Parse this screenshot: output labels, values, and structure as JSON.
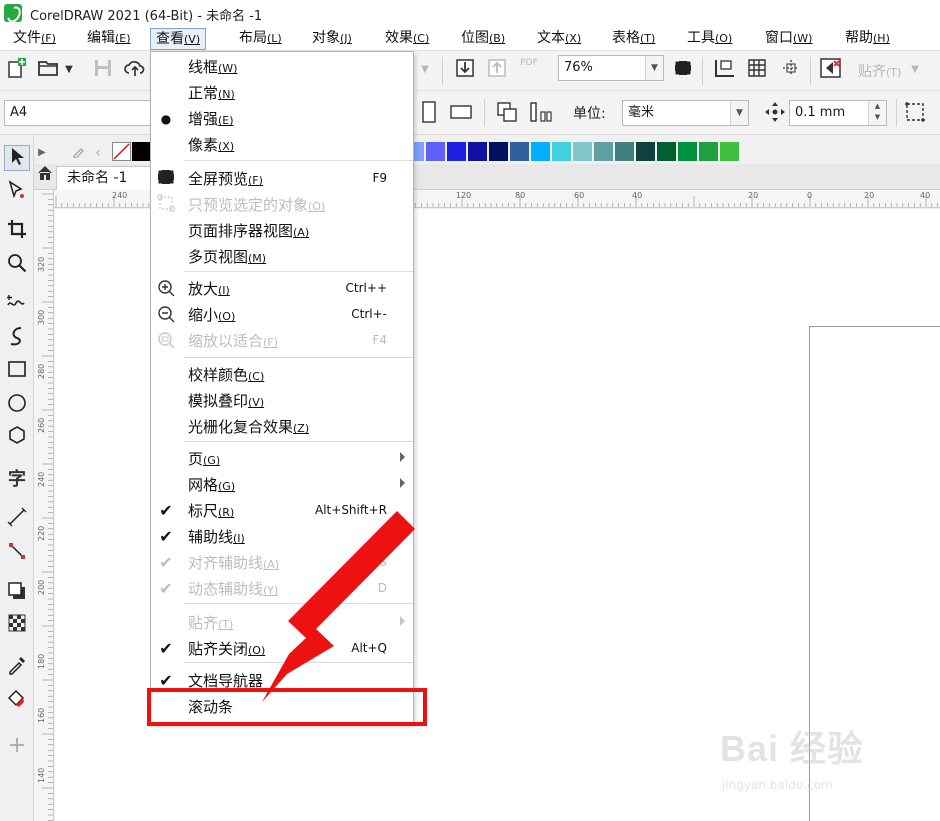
{
  "window": {
    "title": "CorelDRAW 2021 (64-Bit) - 未命名 -1"
  },
  "menubar": [
    {
      "label": "文件",
      "acc": "(F)"
    },
    {
      "label": "编辑",
      "acc": "(E)"
    },
    {
      "label": "查看",
      "acc": "(V)"
    },
    {
      "label": "布局",
      "acc": "(L)"
    },
    {
      "label": "对象",
      "acc": "(J)"
    },
    {
      "label": "效果",
      "acc": "(C)"
    },
    {
      "label": "位图",
      "acc": "(B)"
    },
    {
      "label": "文本",
      "acc": "(X)"
    },
    {
      "label": "表格",
      "acc": "(T)"
    },
    {
      "label": "工具",
      "acc": "(O)"
    },
    {
      "label": "窗口",
      "acc": "(W)"
    },
    {
      "label": "帮助",
      "acc": "(H)"
    }
  ],
  "toolbar": {
    "zoom_value": "76%",
    "snap_label": "贴齐",
    "snap_acc": "(T)",
    "pdf_label": "PDF",
    "page_size": "A4",
    "unit_label": "单位:",
    "unit_value": "毫米",
    "nudge_value": "0.1 mm"
  },
  "document_tab": {
    "label": "未命名 -1"
  },
  "rulers": {
    "horizontal": [
      "240",
      "120",
      "80",
      "60",
      "40",
      "20",
      "0",
      "20",
      "40"
    ],
    "vertical": [
      "320",
      "300",
      "280",
      "260",
      "240",
      "220",
      "200",
      "180",
      "160",
      "140"
    ]
  },
  "palette_colors": [
    "#000000",
    "#ffffff",
    "#ffff00",
    "#00ff00",
    "#ff0000",
    "#ff00ff",
    "#cc00cc",
    "#8000ff",
    "#ff6600",
    "#ff88bb",
    "#6b3030",
    "#c8c8ff",
    "#a8b8ff",
    "#7f9fff",
    "#6060ff",
    "#2020e0",
    "#1010a0",
    "#001060",
    "#3060a0",
    "#00b0ff",
    "#40d0e0",
    "#80c8c8",
    "#60a0a0",
    "#408080",
    "#104040",
    "#006030",
    "#009040",
    "#20a040",
    "#40c040"
  ],
  "view_menu": {
    "items": [
      {
        "label": "线框",
        "acc": "(W)",
        "mark": "",
        "shortcut": "",
        "disabled": false,
        "submenu": false
      },
      {
        "label": "正常",
        "acc": "(N)",
        "mark": "",
        "shortcut": "",
        "disabled": false,
        "submenu": false
      },
      {
        "label": "增强",
        "acc": "(E)",
        "mark": "●",
        "shortcut": "",
        "disabled": false,
        "submenu": false
      },
      {
        "label": "像素",
        "acc": "(X)",
        "mark": "",
        "shortcut": "",
        "disabled": false,
        "submenu": false
      },
      {
        "label": "全屏预览",
        "acc": "(F)",
        "mark": "fullscreen-icon",
        "shortcut": "F9",
        "disabled": false,
        "submenu": false
      },
      {
        "label": "只预览选定的对象",
        "acc": "(O)",
        "mark": "preview-selected-icon",
        "shortcut": "",
        "disabled": true,
        "submenu": false
      },
      {
        "label": "页面排序器视图",
        "acc": "(A)",
        "mark": "",
        "shortcut": "",
        "disabled": false,
        "submenu": false
      },
      {
        "label": "多页视图",
        "acc": "(M)",
        "mark": "",
        "shortcut": "",
        "disabled": false,
        "submenu": false
      },
      {
        "label": "放大",
        "acc": "(I)",
        "mark": "zoom-in-icon",
        "shortcut": "Ctrl++",
        "disabled": false,
        "submenu": false
      },
      {
        "label": "缩小",
        "acc": "(O)",
        "mark": "zoom-out-icon",
        "shortcut": "Ctrl+-",
        "disabled": false,
        "submenu": false
      },
      {
        "label": "缩放以适合",
        "acc": "(F)",
        "mark": "zoom-fit-icon",
        "shortcut": "F4",
        "disabled": true,
        "submenu": false
      },
      {
        "label": "校样颜色",
        "acc": "(C)",
        "mark": "",
        "shortcut": "",
        "disabled": false,
        "submenu": false
      },
      {
        "label": "模拟叠印",
        "acc": "(V)",
        "mark": "",
        "shortcut": "",
        "disabled": false,
        "submenu": false
      },
      {
        "label": "光栅化复合效果",
        "acc": "(Z)",
        "mark": "",
        "shortcut": "",
        "disabled": false,
        "submenu": false
      },
      {
        "label": "页",
        "acc": "(G)",
        "mark": "",
        "shortcut": "",
        "disabled": false,
        "submenu": true
      },
      {
        "label": "网格",
        "acc": "(G)",
        "mark": "",
        "shortcut": "",
        "disabled": false,
        "submenu": true
      },
      {
        "label": "标尺",
        "acc": "(R)",
        "mark": "✔",
        "shortcut": "Alt+Shift+R",
        "disabled": false,
        "submenu": false
      },
      {
        "label": "辅助线",
        "acc": "(I)",
        "mark": "✔",
        "shortcut": "",
        "disabled": false,
        "submenu": false
      },
      {
        "label": "对齐辅助线",
        "acc": "(A)",
        "mark": "✔",
        "shortcut": "Alt+S",
        "disabled": true,
        "submenu": false
      },
      {
        "label": "动态辅助线",
        "acc": "(Y)",
        "mark": "✔",
        "shortcut": "D",
        "disabled": true,
        "submenu": false
      },
      {
        "label": "贴齐",
        "acc": "(T)",
        "mark": "",
        "shortcut": "",
        "disabled": true,
        "submenu": true
      },
      {
        "label": "贴齐关闭",
        "acc": "(O)",
        "mark": "✔",
        "shortcut": "Alt+Q",
        "disabled": false,
        "submenu": false
      },
      {
        "label": "文档导航器",
        "acc": "",
        "mark": "✔",
        "shortcut": "",
        "disabled": false,
        "submenu": false
      },
      {
        "label": "滚动条",
        "acc": "",
        "mark": "",
        "shortcut": "",
        "disabled": false,
        "submenu": false
      }
    ]
  },
  "annotation": {
    "arrow_color": "#ee1111",
    "highlight_color": "#ee1111"
  },
  "watermark": {
    "main": "Bai 经验",
    "sub": "jingyan.baidu.com"
  }
}
